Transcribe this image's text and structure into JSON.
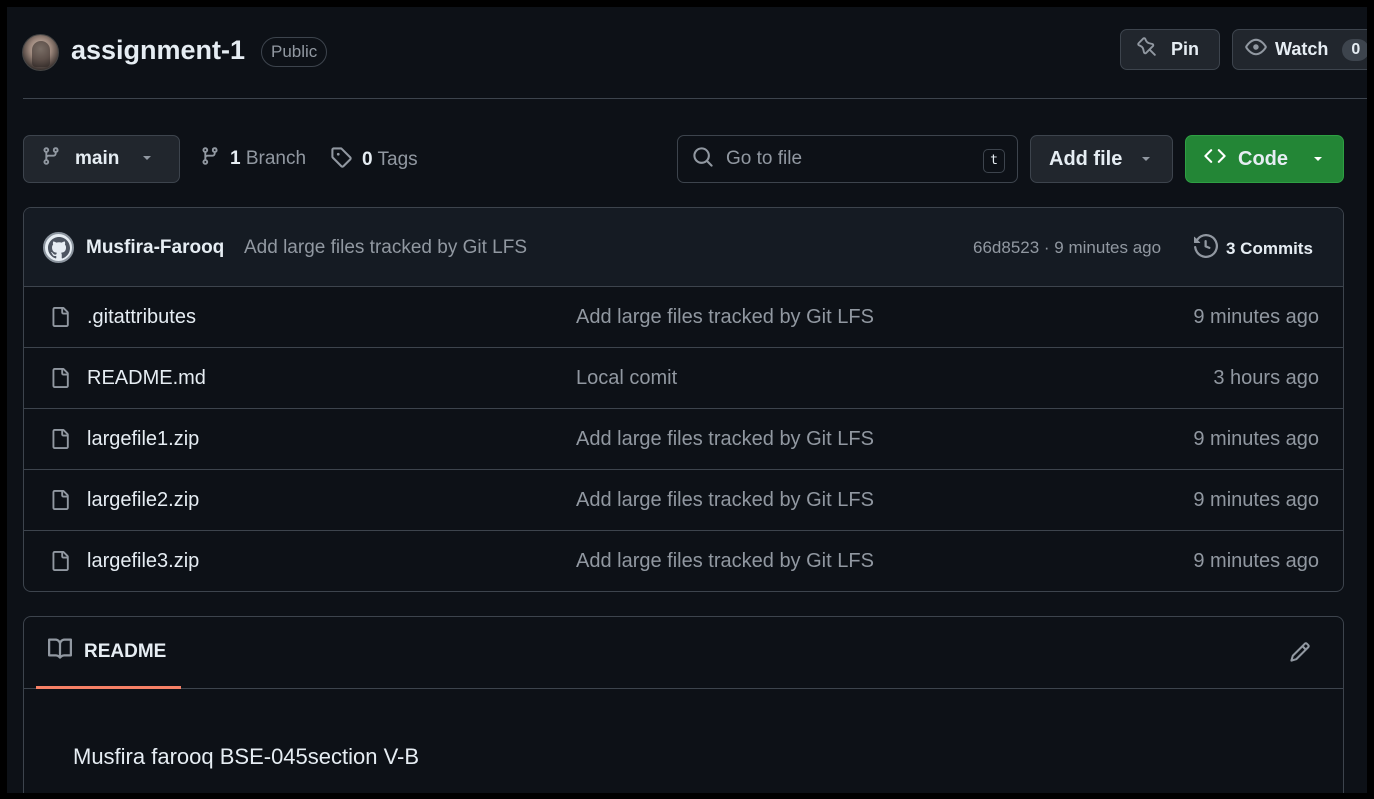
{
  "repo": {
    "name": "assignment-1",
    "visibility": "Public"
  },
  "header_actions": {
    "pin_label": "Pin",
    "watch_label": "Watch",
    "watch_count": "0"
  },
  "toolbar": {
    "branch_name": "main",
    "branch_count": "1",
    "branch_label": "Branch",
    "tag_count": "0",
    "tag_label": "Tags",
    "search_placeholder": "Go to file",
    "search_shortcut": "t",
    "add_file_label": "Add file",
    "code_label": "Code",
    "code_color": "#238636"
  },
  "latest_commit": {
    "author": "Musfira-Farooq",
    "message": "Add large files tracked by Git LFS",
    "sha_time": "66d8523 · 9 minutes ago",
    "commits_label": "3 Commits"
  },
  "files": [
    {
      "name": ".gitattributes",
      "message": "Add large files tracked by Git LFS",
      "time": "9 minutes ago",
      "icon": "file-icon"
    },
    {
      "name": "README.md",
      "message": "Local comit",
      "time": "3 hours ago",
      "icon": "file-icon"
    },
    {
      "name": "largefile1.zip",
      "message": "Add large files tracked by Git LFS",
      "time": "9 minutes ago",
      "icon": "file-icon"
    },
    {
      "name": "largefile2.zip",
      "message": "Add large files tracked by Git LFS",
      "time": "9 minutes ago",
      "icon": "file-icon"
    },
    {
      "name": "largefile3.zip",
      "message": "Add large files tracked by Git LFS",
      "time": "9 minutes ago",
      "icon": "file-icon"
    }
  ],
  "readme": {
    "tab_label": "README",
    "accent_color": "#f78166",
    "content": "Musfira farooq BSE-045section V-B"
  }
}
